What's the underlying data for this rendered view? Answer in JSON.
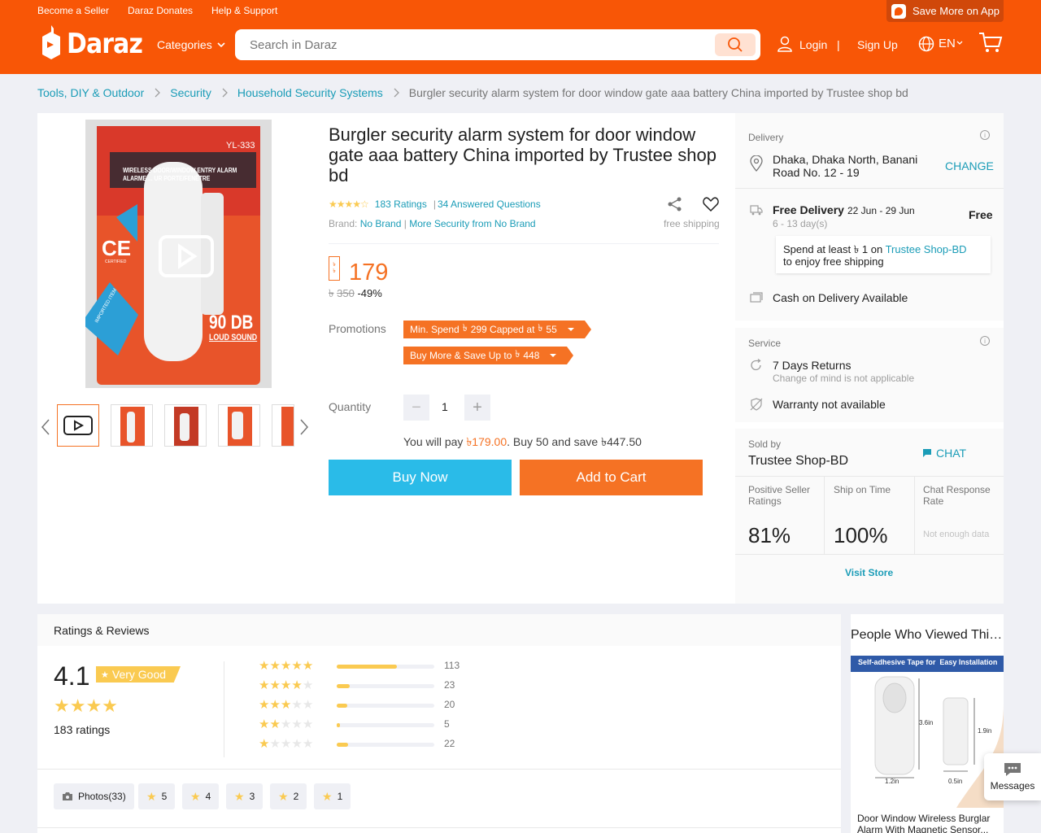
{
  "header": {
    "top_links": [
      "Become a Seller",
      "Daraz Donates",
      "Help & Support"
    ],
    "save_app": "Save More on App",
    "logo_text": "Daraz",
    "categories": "Categories",
    "search_placeholder": "Search in Daraz",
    "login": "Login",
    "signup": "Sign Up",
    "language": "EN",
    "brand_color": "#f85606"
  },
  "breadcrumb": [
    "Tools, DIY & Outdoor",
    "Security",
    "Household Security Systems",
    "Burgler security alarm system for door window gate aaa battery China imported by Trustee shop bd"
  ],
  "product": {
    "title": "Burgler security alarm system for door window gate aaa battery China imported by Trustee shop bd",
    "rating_stars": 4.5,
    "ratings_link": "183 Ratings",
    "questions_link": "34 Answered Questions",
    "brand_label": "Brand:",
    "brand": "No Brand",
    "more_from": "More Security from No Brand",
    "free_shipping": "free shipping",
    "price": "179",
    "old_price": "350",
    "discount": "-49%",
    "promotions_label": "Promotions",
    "promotions": [
      "Min. Spend 299 Capped at 55",
      "Buy More & Save Up to 448"
    ],
    "promo_parts": [
      {
        "a": "Min. Spend",
        "b": "299 Capped at",
        "c": "55"
      },
      {
        "a": "Buy More & Save Up to",
        "b": "448",
        "c": ""
      }
    ],
    "quantity_label": "Quantity",
    "quantity": "1",
    "pay_prefix": "You will pay",
    "pay_amount": "179.00",
    "pay_mid": ". Buy 50 and save",
    "pay_save": "447.50",
    "buy_now": "Buy Now",
    "add_to_cart": "Add to Cart",
    "image_text": {
      "model": "YL-333",
      "line1": "WIRELESS DOOR/WINDOW ENTRY ALARM",
      "line2": "ALARME ... UR PORTE/FENÊTRE",
      "ce": "CE",
      "ce_sub": "CERTIFIED",
      "seal": "IMPORTED ITEM",
      "db": "90 DB",
      "loud": "LOUD SOUND"
    }
  },
  "delivery": {
    "label": "Delivery",
    "address": "Dhaka, Dhaka North, Banani Road No. 12 - 19",
    "change": "CHANGE",
    "free_delivery": "Free Delivery",
    "dates": "22 Jun - 29 Jun",
    "days": "6 - 13 day(s)",
    "fee": "Free",
    "spend_prefix": "Spend at least",
    "spend_amount": "1",
    "spend_on": "on",
    "shop_link": "Trustee Shop-BD",
    "spend_suffix": "to enjoy free shipping",
    "cod": "Cash on Delivery Available"
  },
  "service": {
    "label": "Service",
    "returns": "7 Days Returns",
    "returns_sub": "Change of mind is not applicable",
    "warranty": "Warranty not available"
  },
  "seller": {
    "sold_by": "Sold by",
    "name": "Trustee Shop-BD",
    "chat": "CHAT",
    "metrics": [
      {
        "label": "Positive Seller Ratings",
        "value": "81%"
      },
      {
        "label": "Ship on Time",
        "value": "100%"
      },
      {
        "label": "Chat Response Rate",
        "value": "Not enough data"
      }
    ],
    "visit": "Visit Store"
  },
  "reviews": {
    "heading": "Ratings & Reviews",
    "score": "4.1",
    "badge": "Very Good",
    "total": "183 ratings",
    "breakdown": [
      {
        "stars": 5,
        "count": "113",
        "fraction": 0.62
      },
      {
        "stars": 4,
        "count": "23",
        "fraction": 0.13
      },
      {
        "stars": 3,
        "count": "20",
        "fraction": 0.11
      },
      {
        "stars": 2,
        "count": "5",
        "fraction": 0.03
      },
      {
        "stars": 1,
        "count": "22",
        "fraction": 0.12
      }
    ],
    "filters": [
      "Photos(33)",
      "5",
      "4",
      "3",
      "2",
      "1"
    ]
  },
  "people_viewed": {
    "title": "People Who Viewed This Also Viewed",
    "banner": "Self-adhesive Tape for  Easy Installation",
    "dim1": "3.6in",
    "dim2": "1.9in",
    "dim3": "1.2in",
    "dim4": "0.5in",
    "item_name": "Door Window Wireless Burglar Alarm With Magnetic Sensor..."
  },
  "messages": "Messages"
}
